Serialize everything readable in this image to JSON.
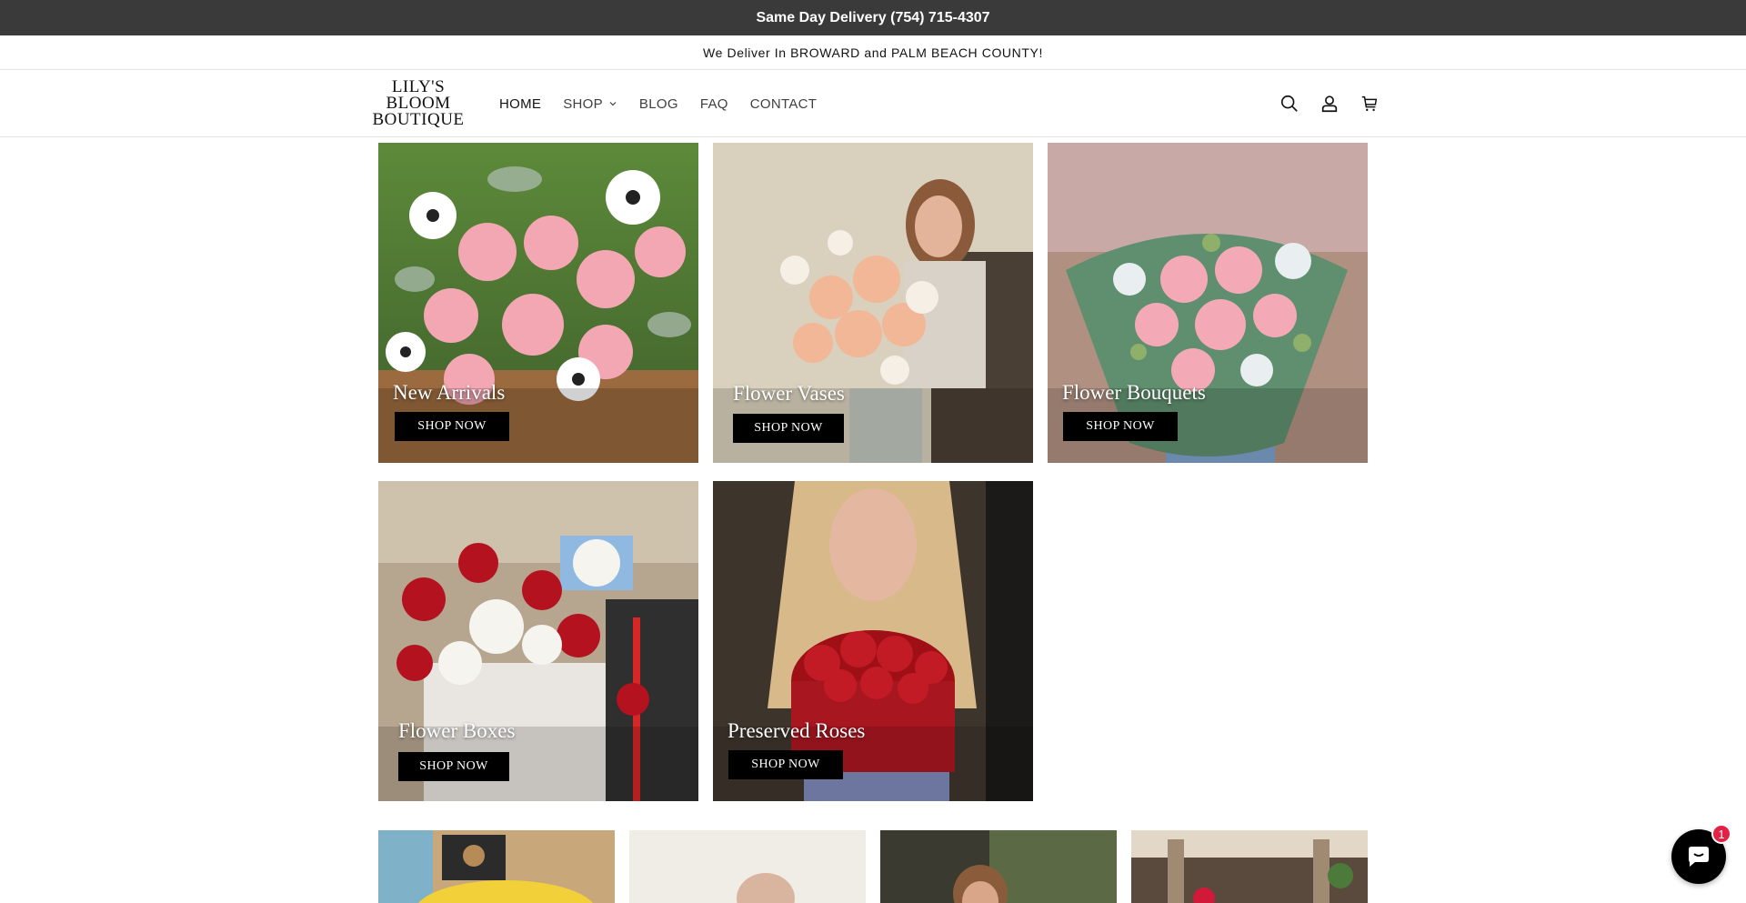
{
  "announcement": {
    "primary": "Same Day Delivery (754) 715-4307",
    "secondary": "We Deliver In BROWARD and PALM BEACH COUNTY!"
  },
  "header": {
    "logo_lines": [
      "LILY'S",
      "BLOOM",
      "BOUTIQUE"
    ],
    "nav": [
      {
        "label": "HOME",
        "active": true
      },
      {
        "label": "SHOP",
        "has_dropdown": true
      },
      {
        "label": "BLOG"
      },
      {
        "label": "FAQ"
      },
      {
        "label": "CONTACT"
      }
    ],
    "icons": [
      "search-icon",
      "account-icon",
      "cart-icon"
    ]
  },
  "collections": [
    {
      "title": "New Arrivals",
      "cta": "SHOP NOW"
    },
    {
      "title": "Flower Vases",
      "cta": "SHOP NOW"
    },
    {
      "title": "Flower Bouquets",
      "cta": "SHOP NOW"
    },
    {
      "title": "Flower Boxes",
      "cta": "SHOP NOW"
    },
    {
      "title": "Preserved Roses",
      "cta": "SHOP NOW"
    }
  ],
  "chat": {
    "badge_count": "1"
  },
  "colors": {
    "topbar": "#3a3a3a",
    "accent_badge": "#e42045",
    "button": "#000000"
  }
}
